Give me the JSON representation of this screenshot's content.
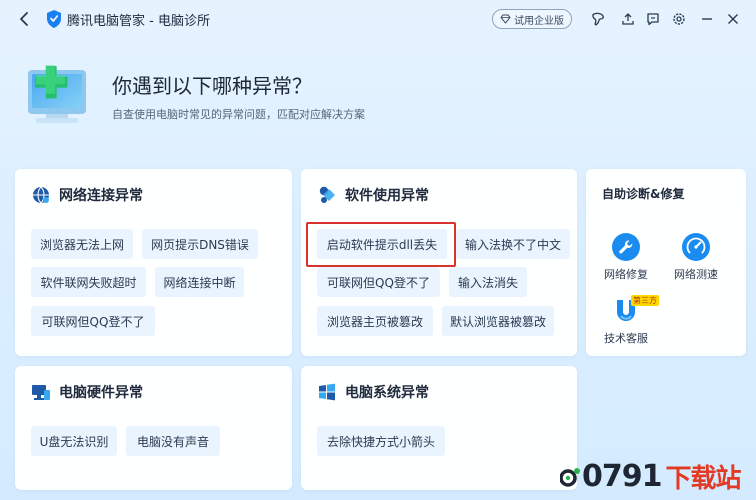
{
  "window": {
    "title": "腾讯电脑管家 - 电脑诊所",
    "trial_label": "试用企业版",
    "icons": [
      "back-icon",
      "shield-logo-icon",
      "diamond-icon",
      "skin-icon",
      "upload-icon",
      "feedback-icon",
      "settings-icon",
      "minimize-icon",
      "close-icon"
    ]
  },
  "hero": {
    "title": "你遇到以下哪种异常？",
    "subtitle": "自查使用电脑时常见的异常问题，匹配对应解决方案"
  },
  "network": {
    "title": "网络连接异常",
    "items": [
      "浏览器无法上网",
      "网页提示DNS错误",
      "软件联网失败超时",
      "网络连接中断",
      "可联网但QQ登不了"
    ]
  },
  "software": {
    "title": "软件使用异常",
    "items": [
      "启动软件提示dll丢失",
      "输入法换不了中文",
      "可联网但QQ登不了",
      "输入法消失",
      "浏览器主页被篡改",
      "默认浏览器被篡改"
    ]
  },
  "hardware": {
    "title": "电脑硬件异常",
    "items": [
      "U盘无法识别",
      "电脑没有声音"
    ]
  },
  "system": {
    "title": "电脑系统异常",
    "items": [
      "去除快捷方式小箭头"
    ]
  },
  "self_help": {
    "title": "自助诊断&修复",
    "tools": [
      {
        "label": "网络修复",
        "icon": "wrench-icon"
      },
      {
        "label": "网络测速",
        "icon": "speedometer-icon"
      },
      {
        "label": "技术客服",
        "icon": "support-icon",
        "badge": "第三方"
      }
    ]
  },
  "watermark": {
    "number": "0791",
    "text": "下载站"
  },
  "colors": {
    "accent": "#1a8cf0",
    "chip_bg": "#e9f4ff",
    "highlight": "#d9342b",
    "watermark_red": "#e23a25",
    "watermark_green": "#2bb24c"
  }
}
